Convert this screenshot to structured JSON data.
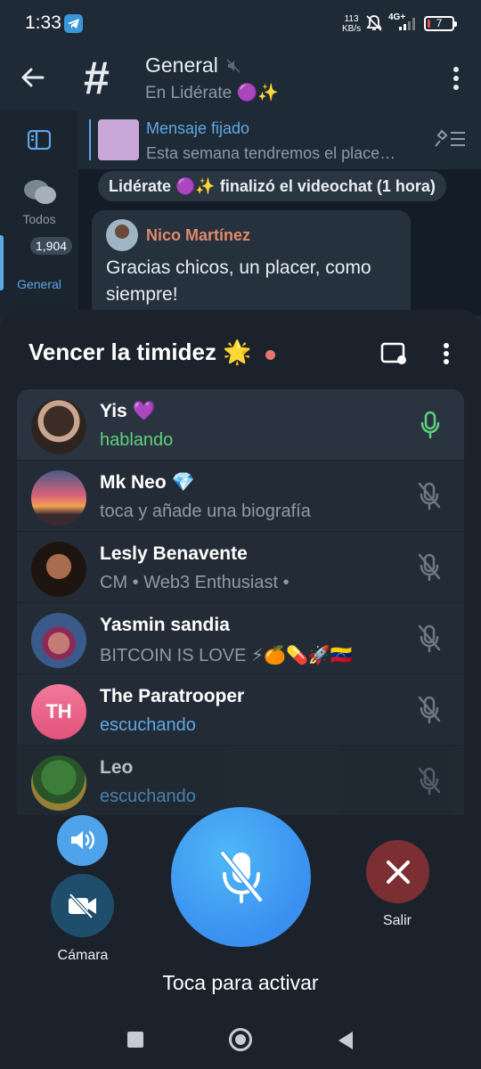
{
  "status_bar": {
    "time": "1:33",
    "speed_value": "113",
    "speed_unit": "KB/s",
    "network": "4G+",
    "battery": "7"
  },
  "header": {
    "title": "General",
    "subtitle": "En Lidérate 🟣✨"
  },
  "sidebar": {
    "todos_label": "Todos",
    "badge_count": "1,904",
    "general_label": "General"
  },
  "pinned": {
    "title": "Mensaje fijado",
    "text": "Esta semana tendremos el place…"
  },
  "service_message": "Lidérate 🟣✨ finalizó el videochat (1 hora)",
  "message": {
    "author": "Nico Martínez",
    "text": "Gracias chicos, un placer, como siempre!"
  },
  "voice_chat": {
    "title": "Vencer la timidez 🌟",
    "participants": [
      {
        "name": "Yis 💜",
        "status": "hablando"
      },
      {
        "name": "Mk Neo 💎",
        "status": "toca y añade una biografía"
      },
      {
        "name": "Lesly Benavente",
        "status": "CM  •  Web3 Enthusiast  •"
      },
      {
        "name": "Yasmin sandia",
        "status": "BITCOIN IS LOVE ⚡🍊💊🚀🇻🇪"
      },
      {
        "name": "The Paratrooper",
        "status": "escuchando",
        "initials": "TH"
      },
      {
        "name": "Leo",
        "status": "escuchando"
      }
    ],
    "camera_label": "Cámara",
    "main_label": "Toca para activar",
    "exit_label": "Salir"
  },
  "colors": {
    "accent": "#5ea8e6",
    "speaking": "#5fd07c",
    "exit": "#7b2f33",
    "main_button": "#3a9bf0"
  }
}
